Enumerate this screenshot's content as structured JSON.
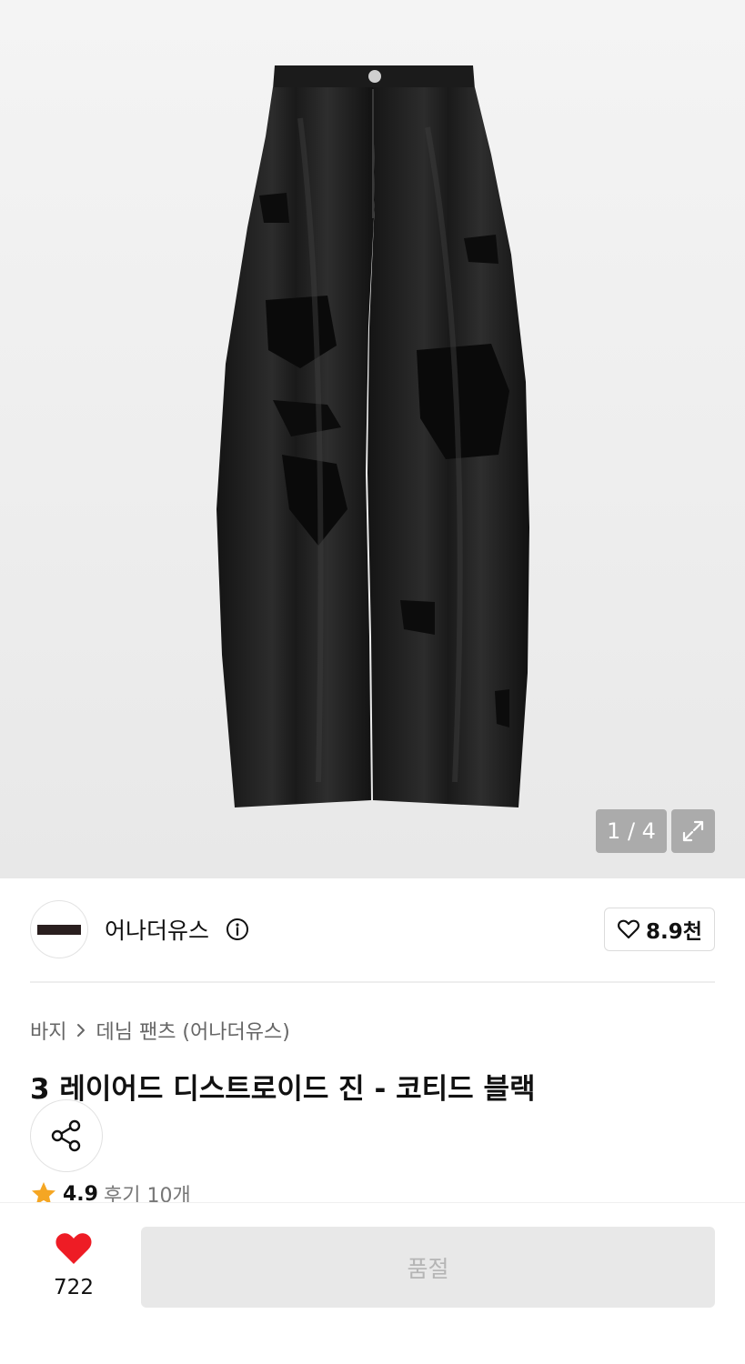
{
  "gallery": {
    "counter": "1 / 4"
  },
  "brand": {
    "name": "어나더유스",
    "like_count": "8.9천"
  },
  "breadcrumb": {
    "category": "바지",
    "subcategory": "데님 팬츠 (어나더유스)"
  },
  "product": {
    "title": "3 레이어드 디스트로이드 진 - 코티드 블랙",
    "rating": "4.9",
    "reviews": "후기 10개"
  },
  "bottom_bar": {
    "wish_count": "722",
    "buy_label": "품절"
  },
  "colors": {
    "wish_heart": "#ee1c25",
    "star": "#f5a623",
    "soldout_bg": "#e8e8e8"
  }
}
